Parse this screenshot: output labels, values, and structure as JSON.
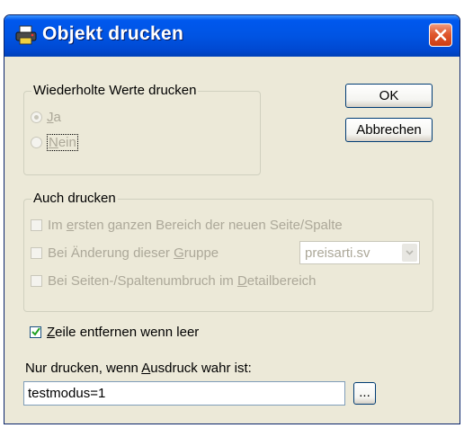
{
  "window": {
    "title": "Objekt drucken",
    "title_icon": "printer-icon",
    "close_icon": "close-icon"
  },
  "repeated_values": {
    "legend": "Wiederholte Werte drucken",
    "options": [
      {
        "pre": "",
        "key": "J",
        "post": "a",
        "selected": true,
        "enabled": false
      },
      {
        "pre": "",
        "key": "N",
        "post": "ein",
        "selected": false,
        "enabled": false
      }
    ]
  },
  "buttons": {
    "ok": "OK",
    "cancel": "Abbrechen",
    "browse": "..."
  },
  "also_print": {
    "legend": "Auch drucken",
    "items": [
      {
        "pre": "Im ",
        "key": "e",
        "post": "rsten ganzen Bereich der neuen Seite/Spalte",
        "checked": false,
        "enabled": false
      },
      {
        "pre": "Bei Änderung dieser ",
        "key": "G",
        "post": "ruppe",
        "checked": false,
        "enabled": false
      },
      {
        "pre": "Bei Seiten-/Spaltenumbruch im ",
        "key": "D",
        "post": "etailbereich",
        "checked": false,
        "enabled": false
      }
    ],
    "group_select": "preisarti.sv"
  },
  "remove_line": {
    "pre": "",
    "key": "Z",
    "post": "eile entfernen wenn leer",
    "checked": true
  },
  "condition": {
    "label_pre": "Nur drucken, wenn ",
    "label_key": "A",
    "label_post": "usdruck wahr ist:",
    "value": "testmodus=1"
  },
  "colors": {
    "titlebar": "#0054e3",
    "dialog_bg": "#ece9d8",
    "disabled_text": "#aca899",
    "close_button": "#e0582e"
  }
}
